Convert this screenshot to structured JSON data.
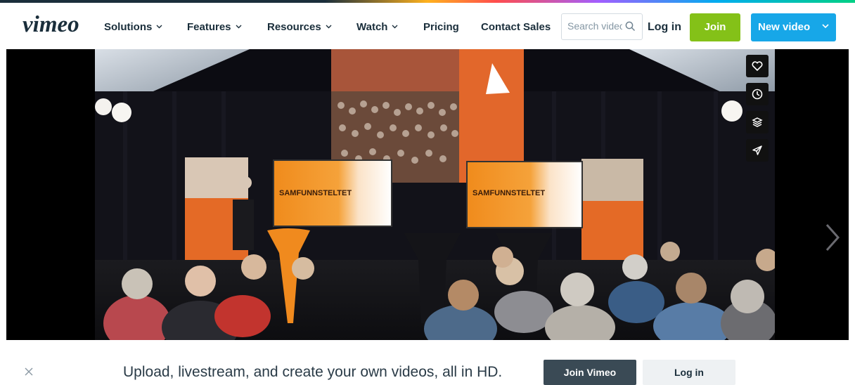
{
  "brand": {
    "logo_text": "vimeo"
  },
  "nav": {
    "items": [
      {
        "label": "Solutions",
        "has_dropdown": true
      },
      {
        "label": "Features",
        "has_dropdown": true
      },
      {
        "label": "Resources",
        "has_dropdown": true
      },
      {
        "label": "Watch",
        "has_dropdown": true
      },
      {
        "label": "Pricing",
        "has_dropdown": false
      },
      {
        "label": "Contact Sales",
        "has_dropdown": false
      }
    ],
    "search_placeholder": "Search videos",
    "login_label": "Log in",
    "join_label": "Join",
    "new_video_label": "New video"
  },
  "player": {
    "screen_left_text": "SAMFUNNSTELTET",
    "screen_right_text": "SAMFUNNSTELTET",
    "actions": [
      "heart-icon",
      "clock-icon",
      "layers-icon",
      "send-icon"
    ],
    "next_icon": "chevron-right-icon"
  },
  "banner": {
    "text": "Upload, livestream, and create your own videos, all in HD.",
    "join_label": "Join Vimeo",
    "login_label": "Log in"
  },
  "colors": {
    "join_green": "#84c118",
    "new_video_blue": "#17a7e8",
    "join_vimeo_dark": "#3a4a55",
    "text_dark": "#1a2e3b"
  }
}
